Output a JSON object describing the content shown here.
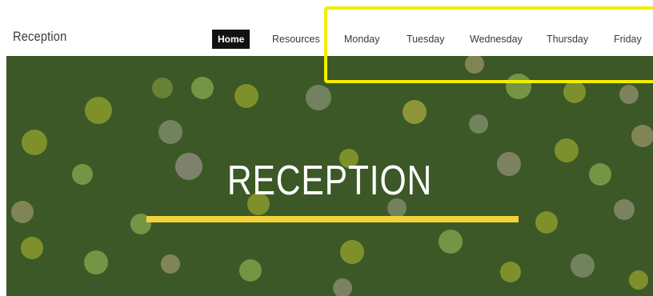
{
  "site": {
    "title": "Reception"
  },
  "nav": {
    "items": [
      {
        "label": "Home",
        "active": true
      },
      {
        "label": "Resources"
      },
      {
        "label": "Monday"
      },
      {
        "label": "Tuesday"
      },
      {
        "label": "Wednesday"
      },
      {
        "label": "Thursday"
      },
      {
        "label": "Friday"
      }
    ]
  },
  "hero": {
    "title": "RECEPTION",
    "background_color": "#3c5826",
    "underline_color": "#f2d23c"
  },
  "annotation": {
    "highlight_color": "#f2ee00"
  }
}
